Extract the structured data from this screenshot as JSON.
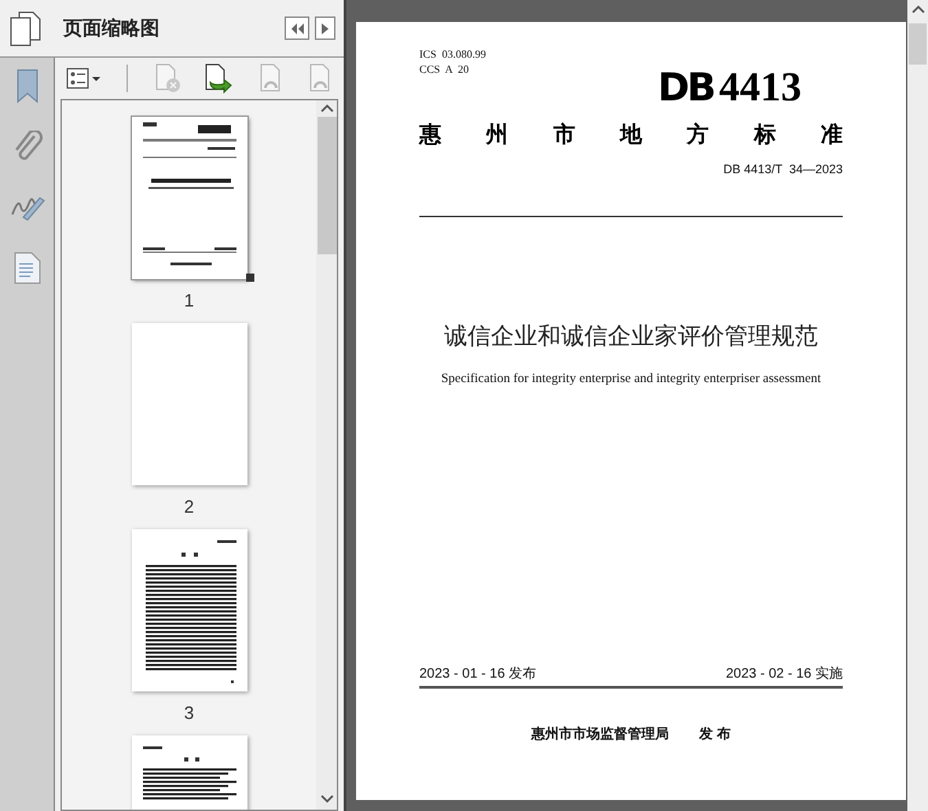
{
  "panel": {
    "title": "页面缩略图"
  },
  "rail": [
    {
      "kind": "bookmark"
    },
    {
      "kind": "attachment"
    },
    {
      "kind": "signature"
    },
    {
      "kind": "document"
    }
  ],
  "toolbar": [
    {
      "kind": "options",
      "disabled": false
    },
    {
      "kind": "delete",
      "disabled": true
    },
    {
      "kind": "insert",
      "disabled": false
    },
    {
      "kind": "rotate-left",
      "disabled": true
    },
    {
      "kind": "rotate-right",
      "disabled": true
    }
  ],
  "thumbnails": [
    {
      "label": "1",
      "kind": "cover",
      "selected": true
    },
    {
      "label": "2",
      "kind": "blank",
      "selected": false
    },
    {
      "label": "3",
      "kind": "contents",
      "selected": false
    },
    {
      "kind": "text",
      "selected": false
    }
  ],
  "document": {
    "codes": [
      "ICS  03.080.99",
      "CCS  A  20"
    ],
    "logo_mark": "DB",
    "logo_number": "4413",
    "category": [
      "惠",
      "州",
      "市",
      "地",
      "方",
      "标",
      "准"
    ],
    "standard_number": "DB 4413/T  34—2023",
    "title": "诚信企业和诚信企业家评价管理规范",
    "subtitle": "Specification for integrity enterprise and integrity enterpriser assessment",
    "issue_date": "2023 - 01 - 16 发布",
    "effective_date": "2023 - 02 - 16 实施",
    "issuer": "惠州市市场监督管理局",
    "issue_word": "发 布"
  }
}
